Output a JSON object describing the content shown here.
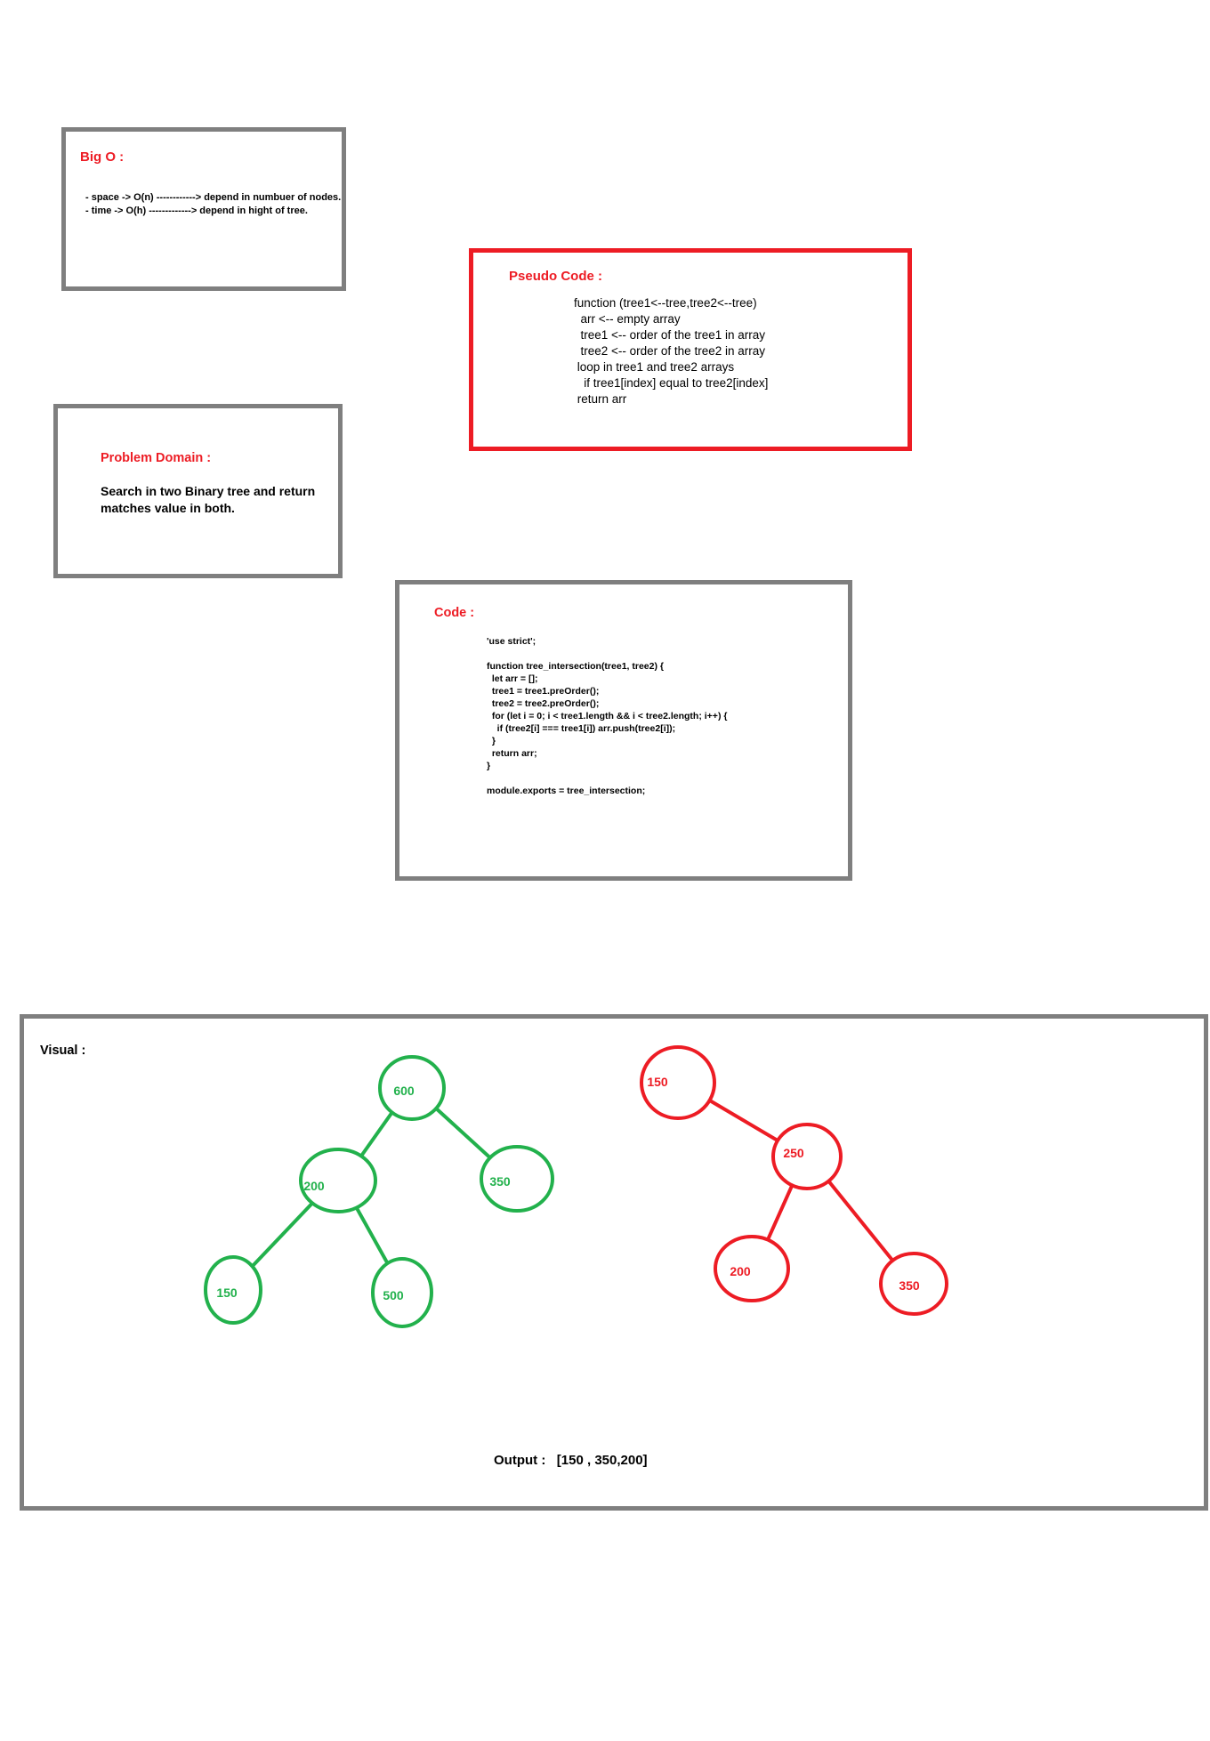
{
  "big_o": {
    "title": "Big O :",
    "lines": [
      "- space -> O(n) ------------> depend in numbuer of nodes.",
      "- time -> O(h) -------------> depend in hight of tree."
    ]
  },
  "pseudo_code": {
    "title": "Pseudo Code :",
    "lines": [
      "function (tree1<--tree,tree2<--tree)",
      "  arr <-- empty array",
      "  tree1 <-- order of the tree1 in array",
      "  tree2 <-- order of the tree2 in array",
      " loop in tree1 and tree2 arrays",
      "   if tree1[index] equal to tree2[index]",
      " return arr"
    ]
  },
  "problem_domain": {
    "title": "Problem Domain :",
    "lines": [
      "Search in two Binary tree and return",
      "matches value in both."
    ]
  },
  "code": {
    "title": "Code :",
    "lines": [
      "'use strict';",
      "",
      "function tree_intersection(tree1, tree2) {",
      "  let arr = [];",
      "  tree1 = tree1.preOrder();",
      "  tree2 = tree2.preOrder();",
      "  for (let i = 0; i < tree1.length && i < tree2.length; i++) {",
      "    if (tree2[i] === tree1[i]) arr.push(tree2[i]);",
      "  }",
      "  return arr;",
      "}",
      "",
      "module.exports = tree_intersection;"
    ]
  },
  "visual": {
    "title": "Visual :",
    "output": "Output :   [150 , 350,200]",
    "colors": {
      "green": "#22b14c",
      "red": "#ed1c24"
    },
    "tree1": {
      "nodes": [
        "600",
        "200",
        "350",
        "150",
        "500"
      ],
      "edges": [
        [
          "600",
          "200"
        ],
        [
          "600",
          "350"
        ],
        [
          "200",
          "150"
        ],
        [
          "200",
          "500"
        ]
      ]
    },
    "tree2": {
      "nodes": [
        "150",
        "250",
        "200",
        "350"
      ],
      "edges": [
        [
          "150",
          "250"
        ],
        [
          "250",
          "200"
        ],
        [
          "250",
          "350"
        ]
      ]
    }
  }
}
